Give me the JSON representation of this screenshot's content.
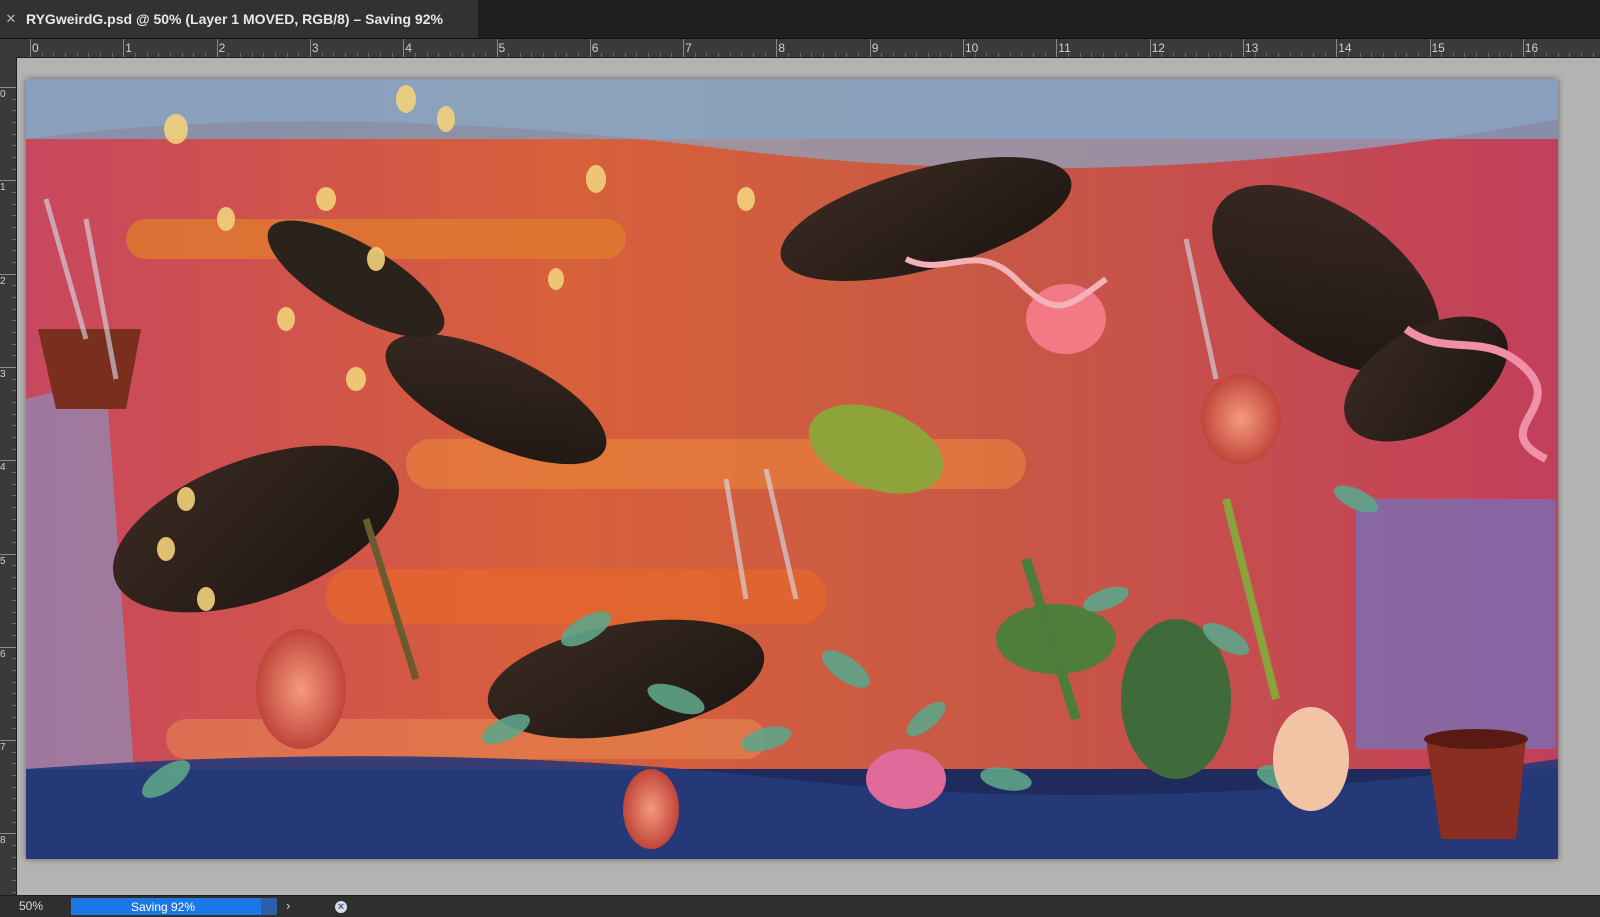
{
  "document": {
    "title": "RYGweirdG.psd @ 50% (Layer 1 MOVED, RGB/8) – Saving 92%",
    "close_glyph": "✕"
  },
  "rulers": {
    "horizontal_labels": [
      "0",
      "1",
      "2",
      "3",
      "4",
      "5",
      "6",
      "7",
      "8",
      "9",
      "10",
      "11",
      "12",
      "13",
      "14",
      "15",
      "16"
    ],
    "vertical_labels": [
      "0",
      "1",
      "2",
      "3",
      "4",
      "5",
      "6",
      "7",
      "8"
    ]
  },
  "status": {
    "zoom": "50%",
    "progress_label": "Saving 92%",
    "progress_percent": 92,
    "cancel_glyph": "×",
    "expand_glyph": "›"
  },
  "colors": {
    "progress_accent": "#1b78e6",
    "canvas_background": "#c24c3a"
  },
  "icons": {
    "tab_close": "close-icon",
    "progress_cancel": "cancel-icon",
    "status_expand": "chevron-right-icon"
  }
}
